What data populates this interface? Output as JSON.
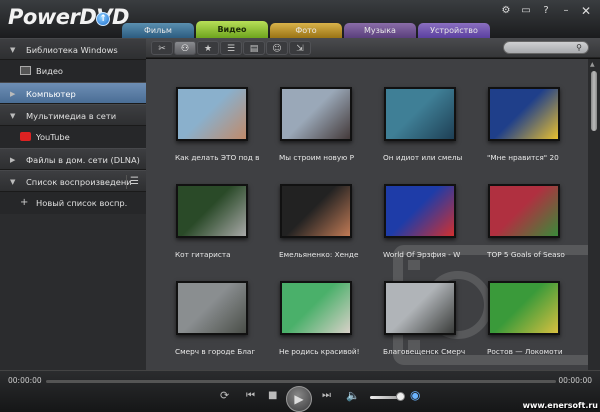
{
  "app": {
    "logo": "PowerDVD"
  },
  "tabs": [
    {
      "label": "Фильм"
    },
    {
      "label": "Видео"
    },
    {
      "label": "Фото"
    },
    {
      "label": "Музыка"
    },
    {
      "label": "Устройство"
    }
  ],
  "sidebar": {
    "items": [
      {
        "label": "Библиотека Windows"
      },
      {
        "label": "Видео"
      },
      {
        "label": "Компьютер"
      },
      {
        "label": "Мультимедиа в сети"
      },
      {
        "label": "YouTube"
      },
      {
        "label": "Файлы в дом. сети (DLNA)"
      },
      {
        "label": "Список воспроизведени"
      },
      {
        "label": "Новый список воспр."
      }
    ]
  },
  "search": {
    "placeholder": ""
  },
  "videos": [
    {
      "caption": "Как делать ЭТО под в",
      "c1": "#8ab0cc",
      "c2": "#c08a6a"
    },
    {
      "caption": "Мы строим новую Р",
      "c1": "#9aa8b8",
      "c2": "#443a3a"
    },
    {
      "caption": "Он идиот или смелы",
      "c1": "#3f7f96",
      "c2": "#1e3f55"
    },
    {
      "caption": "\"Мне нравится\" 20",
      "c1": "#1f3f8a",
      "c2": "#e8c030"
    },
    {
      "caption": "Кот гитариста",
      "c1": "#2a4a28",
      "c2": "#a8a8a8"
    },
    {
      "caption": "Емельяненко: Хенде",
      "c1": "#222",
      "c2": "#c07a55"
    },
    {
      "caption": "World Of Эрзфия - W",
      "c1": "#1e3ca8",
      "c2": "#d03030"
    },
    {
      "caption": "TOP 5 Goals of Seaso",
      "c1": "#b03040",
      "c2": "#3a8a3a"
    },
    {
      "caption": "Смерч в городе Благ",
      "c1": "#8a8e90",
      "c2": "#4a4e48"
    },
    {
      "caption": "Не родись красивой!",
      "c1": "#4ab06a",
      "c2": "#d8d0c8"
    },
    {
      "caption": "Благовещенск Смерч",
      "c1": "#b0b4b8",
      "c2": "#3a3c3a"
    },
    {
      "caption": "Ростов — Локомоти",
      "c1": "#3a9a3a",
      "c2": "#d8c040"
    }
  ],
  "player": {
    "time_current": "00:00:00",
    "time_total": "00:00:00"
  },
  "watermark": "www.enersoft.ru"
}
